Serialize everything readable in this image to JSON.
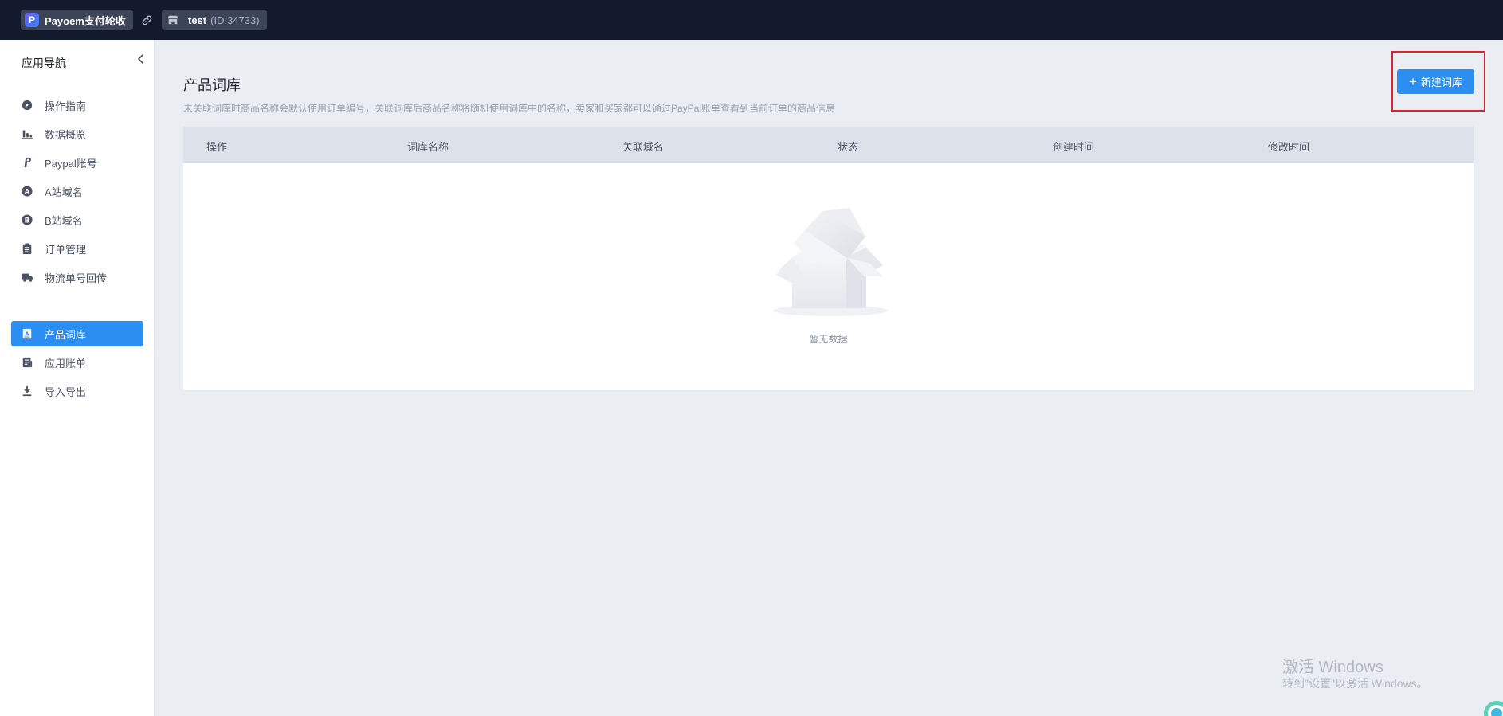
{
  "topbar": {
    "app_name": "Payoem支付轮收",
    "store_name": "test",
    "store_id": "(ID:34733)"
  },
  "sidebar": {
    "title": "应用导航",
    "items": [
      {
        "label": "操作指南",
        "icon": "guide-icon",
        "active": false
      },
      {
        "label": "数据概览",
        "icon": "bar-chart-icon",
        "active": false
      },
      {
        "label": "Paypal账号",
        "icon": "paypal-icon",
        "active": false
      },
      {
        "label": "A站域名",
        "icon": "a-circle-icon",
        "active": false
      },
      {
        "label": "B站域名",
        "icon": "b-circle-icon",
        "active": false
      },
      {
        "label": "订单管理",
        "icon": "clipboard-icon",
        "active": false
      },
      {
        "label": "物流单号回传",
        "icon": "truck-icon",
        "active": false
      },
      {
        "label": "产品词库",
        "icon": "dictionary-icon",
        "active": true
      },
      {
        "label": "应用账单",
        "icon": "bill-icon",
        "active": false
      },
      {
        "label": "导入导出",
        "icon": "download-icon",
        "active": false
      }
    ]
  },
  "main": {
    "title": "产品词库",
    "description": "未关联词库时商品名称会默认使用订单编号，关联词库后商品名称将随机使用词库中的名称，卖家和买家都可以通过PayPal账单查看到当前订单的商品信息",
    "new_button": "新建词库",
    "table": {
      "columns": [
        "操作",
        "词库名称",
        "关联域名",
        "状态",
        "创建时间",
        "修改时间"
      ],
      "empty_text": "暂无数据"
    }
  },
  "watermark": {
    "title": "激活 Windows",
    "subtitle": "转到\"设置\"以激活 Windows。"
  },
  "colors": {
    "topbar": "#131a2e",
    "accent": "#2b8ef0",
    "highlight_frame": "#d8262e"
  }
}
